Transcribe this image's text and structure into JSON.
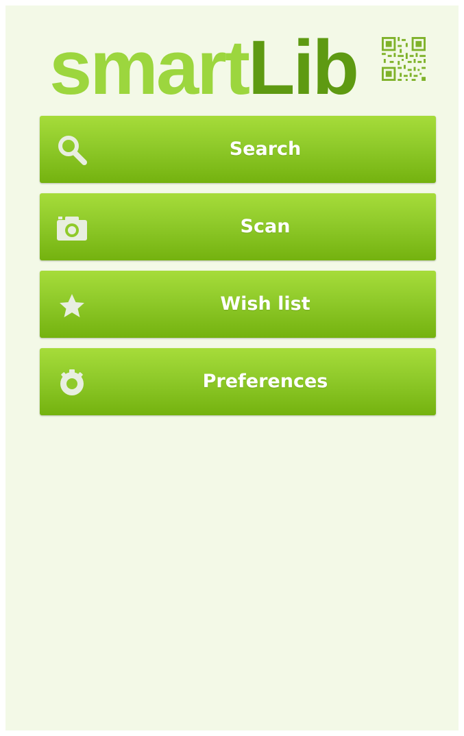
{
  "app": {
    "logo_part1": "smart",
    "logo_part2": "Lib"
  },
  "colors": {
    "background": "#f3f9e7",
    "logo_light": "#9cd63e",
    "logo_dark": "#5e9a12",
    "button_top": "#a6dc3a",
    "button_bottom": "#74b20f",
    "button_text": "#ffffff",
    "icon": "#e8eee0"
  },
  "menu": {
    "items": [
      {
        "label": "Search",
        "icon": "search-icon"
      },
      {
        "label": "Scan",
        "icon": "camera-icon"
      },
      {
        "label": "Wish list",
        "icon": "star-icon"
      },
      {
        "label": "Preferences",
        "icon": "gear-icon"
      }
    ]
  }
}
